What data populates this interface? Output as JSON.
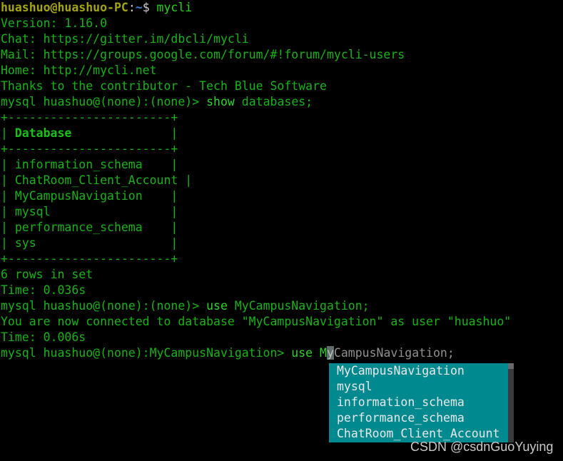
{
  "terminal": {
    "shell_prompt": {
      "user_host": "huashuo@huashuo-PC",
      "colon": ":",
      "path": "~",
      "dollar": "$",
      "command": " mycli"
    },
    "banner": {
      "version": "Version: 1.16.0",
      "chat": "Chat: https://gitter.im/dbcli/mycli",
      "mail": "Mail: https://groups.google.com/forum/#!forum/mycli-users",
      "home": "Home: http://mycli.net",
      "thanks": "Thanks to the contributor - Tech Blue Software"
    },
    "query1": {
      "prompt": "mysql huashuo@(none):(none)> ",
      "keyword": "show",
      "rest": " databases;"
    },
    "table": {
      "top_border": "+-----------------------+",
      "header_left": "| ",
      "header_text": "Database",
      "header_right": "              |",
      "mid_border": "+-----------------------+",
      "rows": [
        "| information_schema    |",
        "| ChatRoom_Client_Account |",
        "| MyCampusNavigation    |",
        "| mysql                 |",
        "| performance_schema    |",
        "| sys                   |"
      ],
      "bottom_border": "+-----------------------+"
    },
    "result1": {
      "rows_in_set": "6 rows in set",
      "time": "Time: 0.036s"
    },
    "query2": {
      "prompt": "mysql huashuo@(none):(none)> ",
      "keyword": "use",
      "rest": " MyCampusNavigation;"
    },
    "result2": {
      "connected": "You are now connected to database \"MyCampusNavigation\" as user \"huashuo\"",
      "time": "Time: 0.006s"
    },
    "query3": {
      "prompt": "mysql huashuo@(none):MyCampusNavigation> ",
      "keyword": "use",
      "typed_before_cursor": " M",
      "cursor_char": "y",
      "ghost_after_cursor": "CampusNavigation;"
    }
  },
  "autocomplete": {
    "items": [
      "MyCampusNavigation",
      "mysql",
      "information_schema",
      "performance_schema",
      "ChatRoom_Client_Account"
    ]
  },
  "watermark": {
    "text": "CSDN @csdnGuoYuying"
  },
  "colors": {
    "background": "#000000",
    "text_green": "#18b218",
    "keyword_green": "#2fd42f",
    "user_yellow": "#a5a511",
    "path_blue": "#3a7fd5",
    "dropdown_teal": "#00898f",
    "dropdown_text": "#e8e8e8",
    "scrollbar_track": "#3b3b3b",
    "watermark_gray": "#c9c9c9"
  }
}
